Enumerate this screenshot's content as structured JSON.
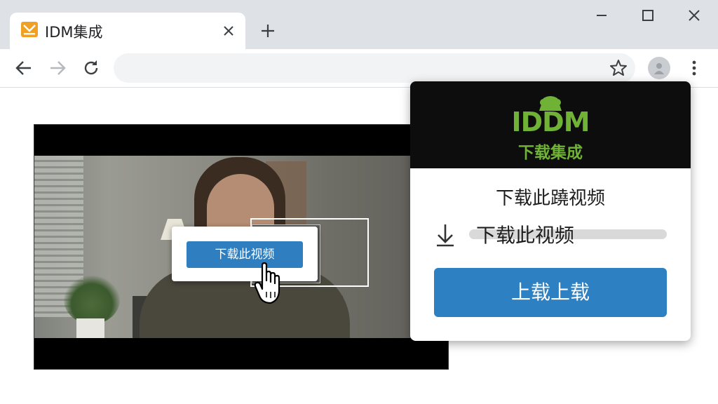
{
  "browser": {
    "tab_title": "IDM集成",
    "address_value": "",
    "address_placeholder": ""
  },
  "video_overlay": {
    "download_button": "下载此视频"
  },
  "idm_popup": {
    "logo_text": "IDDM",
    "subtitle": "下载集成",
    "heading": "下载此蹺视频",
    "item_label": "下载此视频",
    "action_button": "上载上载"
  },
  "colors": {
    "accent_blue": "#2d80c2",
    "idm_green": "#6fb236",
    "chrome_bg": "#dee1e6"
  },
  "icons": [
    "back-icon",
    "forward-icon",
    "reload-icon",
    "star-icon",
    "profile-icon",
    "menu-icon",
    "minimize-icon",
    "maximize-icon",
    "close-window-icon",
    "tab-close-icon",
    "new-tab-icon",
    "download-arrow-icon",
    "hand-cursor-icon"
  ]
}
